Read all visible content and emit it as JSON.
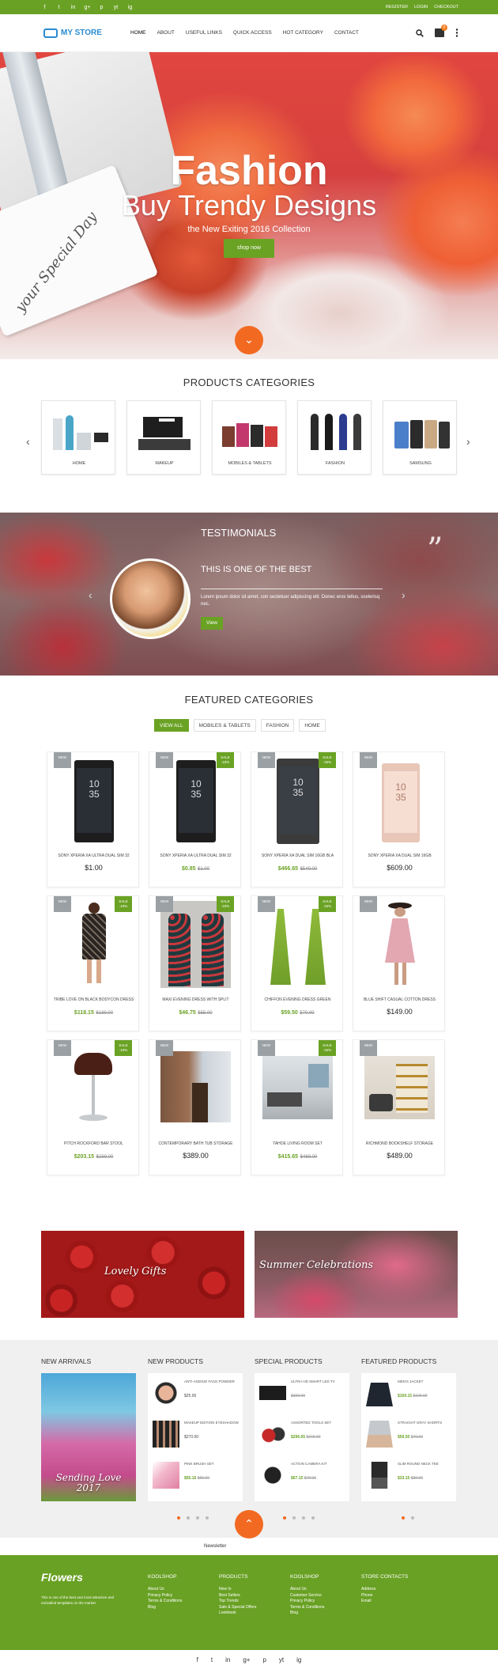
{
  "topbar": {
    "social_icons": [
      "f",
      "t",
      "in",
      "g+",
      "p",
      "yt",
      "ig"
    ],
    "links": [
      "Register",
      "Login",
      "Checkout"
    ]
  },
  "header": {
    "logo_text": "MY STORE",
    "nav": [
      "Home",
      "About",
      "Useful Links",
      "Quick Access",
      "Hot Category",
      "Contact"
    ],
    "cart_count": "0"
  },
  "hero": {
    "title": "Fashion",
    "subtitle": "Buy Trendy Designs",
    "tagline": "the New Exiting 2016 Collection",
    "button": "shop now",
    "tag_text": "your Special Day"
  },
  "categories": {
    "title": "Products Categories",
    "items": [
      {
        "label": "Home"
      },
      {
        "label": "Makeup"
      },
      {
        "label": "Mobiles & Tablets"
      },
      {
        "label": "Fashion"
      },
      {
        "label": "Samsung"
      }
    ]
  },
  "testimonials": {
    "title": "Testimonials",
    "heading": "This is one of the best",
    "body": "Lorem ipsum dolor sit amet, con sectetuer adipiscing elit. Donec eros tellus, scelerisq nec.",
    "button": "View"
  },
  "featured": {
    "title": "Featured Categories",
    "tabs": [
      "View All",
      "Mobiles & Tablets",
      "Fashion",
      "Home"
    ],
    "products": [
      {
        "name": "SONY XPERIA XA ULTRA DUAL SIM 32",
        "price": "$1.00",
        "sale_price": "",
        "old_price": "",
        "badge_new": "NEW",
        "badge_sale": ""
      },
      {
        "name": "SONY XPERIA XA ULTRA DUAL SIM 32",
        "price": "",
        "sale_price": "$0.85",
        "old_price": "$1.00",
        "badge_new": "NEW",
        "badge_sale": "SALE -15%"
      },
      {
        "name": "SONY XPERIA XA DUAL SIM 16GB BLA",
        "price": "",
        "sale_price": "$466.65",
        "old_price": "$549.00",
        "badge_new": "NEW",
        "badge_sale": "SALE -15%"
      },
      {
        "name": "SONY XPERIA XA DUAL SIM 16GB",
        "price": "$609.00",
        "sale_price": "",
        "old_price": "",
        "badge_new": "NEW",
        "badge_sale": ""
      },
      {
        "name": "TRIBE LOVE ON BLACK BODYCON DRESS",
        "price": "",
        "sale_price": "$118.15",
        "old_price": "$139.00",
        "badge_new": "NEW",
        "badge_sale": "SALE -15%"
      },
      {
        "name": "MAXI EVENING DRESS WITH SPLIT",
        "price": "",
        "sale_price": "$46.75",
        "old_price": "$55.00",
        "badge_new": "NEW",
        "badge_sale": "SALE -15%"
      },
      {
        "name": "CHIFFON EVENING DRESS GREEN",
        "price": "",
        "sale_price": "$59.50",
        "old_price": "$70.00",
        "badge_new": "NEW",
        "badge_sale": "SALE -15%"
      },
      {
        "name": "BLUE SHIFT CASUAL COTTON DRESS",
        "price": "$149.00",
        "sale_price": "",
        "old_price": "",
        "badge_new": "NEW",
        "badge_sale": ""
      },
      {
        "name": "PITCH ROCKFORD BAR STOOL",
        "price": "",
        "sale_price": "$203.15",
        "old_price": "$239.00",
        "badge_new": "NEW",
        "badge_sale": "SALE -15%"
      },
      {
        "name": "CONTEMPORARY BATH TUB STORAGE",
        "price": "$389.00",
        "sale_price": "",
        "old_price": "",
        "badge_new": "NEW",
        "badge_sale": ""
      },
      {
        "name": "TAHOE LIVING ROOM SET",
        "price": "",
        "sale_price": "$415.65",
        "old_price": "$489.00",
        "badge_new": "NEW",
        "badge_sale": "SALE -15%"
      },
      {
        "name": "RICHMOND BOOKSHELF STORAGE",
        "price": "$489.00",
        "sale_price": "",
        "old_price": "",
        "badge_new": "NEW",
        "badge_sale": ""
      }
    ]
  },
  "banners": [
    {
      "text": "Lovely Gifts"
    },
    {
      "text": "Summer Celebrations"
    }
  ],
  "lists": {
    "new_arrivals": {
      "title": "New Arrivals",
      "image_text": "Sending Love 2017"
    },
    "new_products": {
      "title": "New Products",
      "items": [
        {
          "name": "ANTI-AGEING FACE POWDER",
          "sale": "",
          "price": "$25.00"
        },
        {
          "name": "MAKEUP EDITION EYESHADOW",
          "sale": "",
          "price": "$270.00"
        },
        {
          "name": "PINK BRUSH SET",
          "sale": "$55.16",
          "price": "$65.00"
        }
      ]
    },
    "special_products": {
      "title": "Special Products",
      "items": [
        {
          "name": "ULTRA HD SMART LED TV",
          "sale": "",
          "price": "$399.00"
        },
        {
          "name": "ASSORTED TOOLS SET",
          "sale": "$296.65",
          "price": "$349.00"
        },
        {
          "name": "ACTION CAMERA KIT",
          "sale": "$67.15",
          "price": "$79.00"
        }
      ]
    },
    "featured_products": {
      "title": "Featured Products",
      "items": [
        {
          "name": "MEN'S JACKET",
          "sale": "$169.15",
          "price": "$199.00"
        },
        {
          "name": "STRAIGHT GRAY SHORTS",
          "sale": "$59.50",
          "price": "$70.00"
        },
        {
          "name": "SLIM ROUND NECK TEE",
          "sale": "$33.15",
          "price": "$39.00"
        }
      ]
    }
  },
  "newsletter": {
    "text": "Newsletter"
  },
  "footer": {
    "logo": "Flowers",
    "description": "This is one of the best and most attractive and unrivalled templates on the market",
    "cols": [
      {
        "title": "Koolshop",
        "items": [
          "About Us",
          "Privacy Policy",
          "Terms & Conditions",
          "Blog"
        ]
      },
      {
        "title": "Products",
        "items": [
          "New In",
          "Best Sellers",
          "Top Trends",
          "Sale & Special Offers",
          "Lookbook"
        ]
      },
      {
        "title": "Koolshop",
        "items": [
          "About Us",
          "Customer Service",
          "Privacy Policy",
          "Terms & Conditions",
          "Blog"
        ]
      },
      {
        "title": "Store Contacts",
        "items": [
          "Address",
          "Phone",
          "Email"
        ]
      }
    ]
  },
  "bottom_social": [
    "f",
    "t",
    "in",
    "g+",
    "p",
    "yt",
    "ig"
  ],
  "colors": {
    "accent": "#69a124",
    "orange": "#f26a21",
    "logo_blue": "#2a8bd0"
  }
}
